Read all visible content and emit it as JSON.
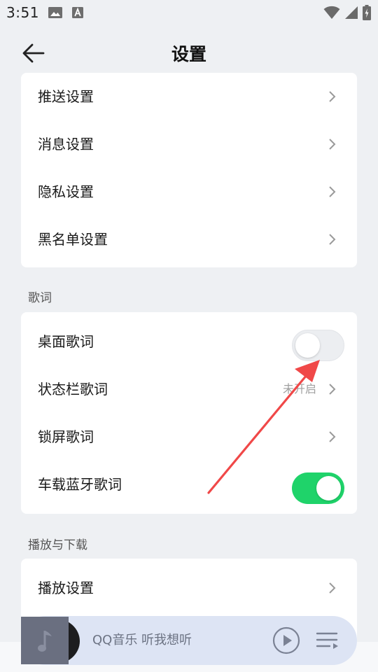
{
  "status_bar": {
    "time": "3:51",
    "left_icons": [
      "image-icon",
      "font-icon"
    ],
    "right_icons": [
      "wifi-icon",
      "signal-icon",
      "battery-icon"
    ]
  },
  "header": {
    "title": "设置",
    "back_icon": "arrow-left-icon"
  },
  "general_items": [
    {
      "label": "推送设置"
    },
    {
      "label": "消息设置"
    },
    {
      "label": "隐私设置"
    },
    {
      "label": "黑名单设置"
    }
  ],
  "lyrics_section": {
    "title": "歌词",
    "items": [
      {
        "label": "桌面歌词",
        "control": "toggle",
        "on": false
      },
      {
        "label": "状态栏歌词",
        "control": "chevron",
        "value": "未开启"
      },
      {
        "label": "锁屏歌词",
        "control": "chevron"
      },
      {
        "label": "车载蓝牙歌词",
        "control": "toggle",
        "on": true
      }
    ]
  },
  "playback_section": {
    "title": "播放与下载",
    "items": [
      {
        "label": "播放设置"
      }
    ]
  },
  "mini_player": {
    "text": "QQ音乐 听我想听",
    "play_icon": "play-icon",
    "playlist_icon": "playlist-icon"
  },
  "colors": {
    "background": "#eef0f3",
    "card": "#ffffff",
    "toggle_on": "#1fd36a",
    "annotation_arrow": "#f04848",
    "player_bg": "#dde4f4"
  },
  "annotation": {
    "type": "arrow",
    "points_to": "桌面歌词 toggle"
  }
}
